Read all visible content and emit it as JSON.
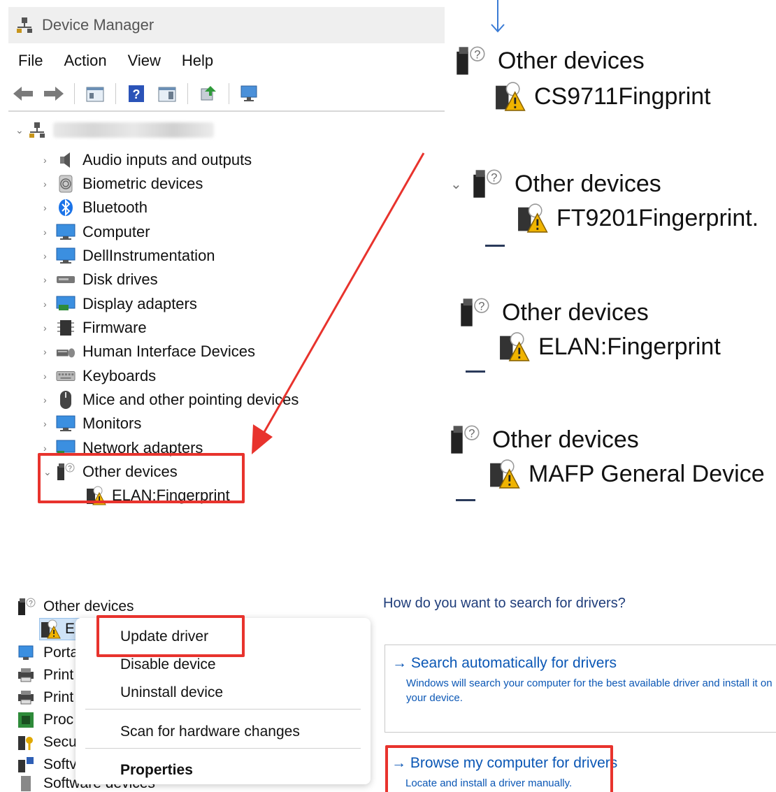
{
  "window": {
    "title": "Device Manager"
  },
  "menu": [
    "File",
    "Action",
    "View",
    "Help"
  ],
  "tree": {
    "categories": [
      {
        "label": "Audio inputs and outputs",
        "icon": "speaker-icon"
      },
      {
        "label": "Biometric devices",
        "icon": "fingerprint-icon"
      },
      {
        "label": "Bluetooth",
        "icon": "bluetooth-icon"
      },
      {
        "label": "Computer",
        "icon": "computer-icon"
      },
      {
        "label": "DellInstrumentation",
        "icon": "monitor-icon"
      },
      {
        "label": "Disk drives",
        "icon": "disk-icon"
      },
      {
        "label": "Display adapters",
        "icon": "display-adapter-icon"
      },
      {
        "label": "Firmware",
        "icon": "chip-icon"
      },
      {
        "label": "Human Interface Devices",
        "icon": "hid-icon"
      },
      {
        "label": "Keyboards",
        "icon": "keyboard-icon"
      },
      {
        "label": "Mice and other pointing devices",
        "icon": "mouse-icon"
      },
      {
        "label": "Monitors",
        "icon": "monitor-icon"
      },
      {
        "label": "Network adapters",
        "icon": "network-icon"
      }
    ],
    "other_devices": {
      "label": "Other devices",
      "child": "ELAN:Fingerprint"
    }
  },
  "variants": [
    {
      "header": "Other devices",
      "device": "CS9711Fingprint"
    },
    {
      "header": "Other devices",
      "device": "FT9201Fingerprint."
    },
    {
      "header": "Other devices",
      "device": "ELAN:Fingerprint"
    },
    {
      "header": "Other devices",
      "device": "MAFP General Device"
    }
  ],
  "context_panel": {
    "tree_header": "Other devices",
    "tree_items": [
      "E",
      "Porta",
      "Print",
      "Print",
      "Proc",
      "Secu",
      "Softv",
      "Software devices"
    ],
    "menu": {
      "update": "Update driver",
      "disable": "Disable device",
      "uninstall": "Uninstall device",
      "scan": "Scan for hardware changes",
      "properties": "Properties"
    }
  },
  "driver_search": {
    "title": "How do you want to search for drivers?",
    "auto": {
      "label": "Search automatically for drivers",
      "desc": "Windows will search your computer for the best available driver and install it on your device."
    },
    "browse": {
      "label": "Browse my computer for drivers",
      "desc": "Locate and install a driver manually."
    }
  },
  "colors": {
    "highlight": "#e8332d",
    "link": "#0b57b5",
    "warning": "#f0b400"
  }
}
